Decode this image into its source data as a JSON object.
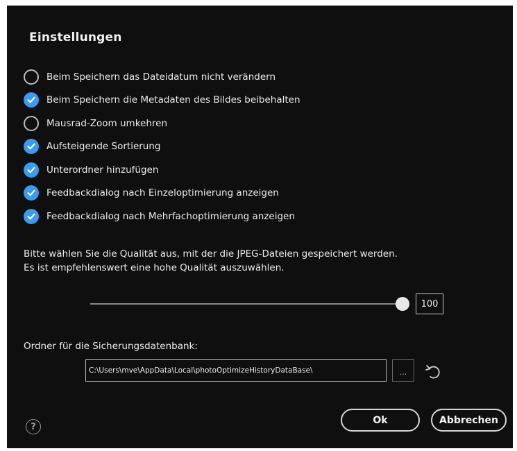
{
  "dialog": {
    "title": "Einstellungen"
  },
  "options": [
    {
      "label": "Beim Speichern das Dateidatum nicht verändern",
      "checked": false
    },
    {
      "label": "Beim Speichern die Metadaten des Bildes beibehalten",
      "checked": true
    },
    {
      "label": "Mausrad-Zoom umkehren",
      "checked": false
    },
    {
      "label": "Aufsteigende Sortierung",
      "checked": true
    },
    {
      "label": "Unterordner hinzufügen",
      "checked": true
    },
    {
      "label": "Feedbackdialog nach Einzeloptimierung anzeigen",
      "checked": true
    },
    {
      "label": "Feedbackdialog nach Mehrfachoptimierung anzeigen",
      "checked": true
    }
  ],
  "quality": {
    "description_line1": "Bitte wählen Sie die Qualität aus, mit der die JPEG-Dateien gespeichert werden.",
    "description_line2": "Es ist empfehlenswert eine hohe Qualität auszuwählen.",
    "value": "100",
    "slider_fraction": 1.0
  },
  "backup": {
    "label": "Ordner für die Sicherungsdatenbank:",
    "path": "C:\\Users\\mve\\AppData\\Local\\photoOptimizeHistoryDataBase\\",
    "browse_label": "...",
    "reset_icon": "undo-icon"
  },
  "footer": {
    "help_label": "?",
    "ok_label": "Ok",
    "cancel_label": "Abbrechen"
  },
  "colors": {
    "background": "#0f0f0f",
    "accent": "#3a9bf0",
    "text": "#ececec"
  }
}
